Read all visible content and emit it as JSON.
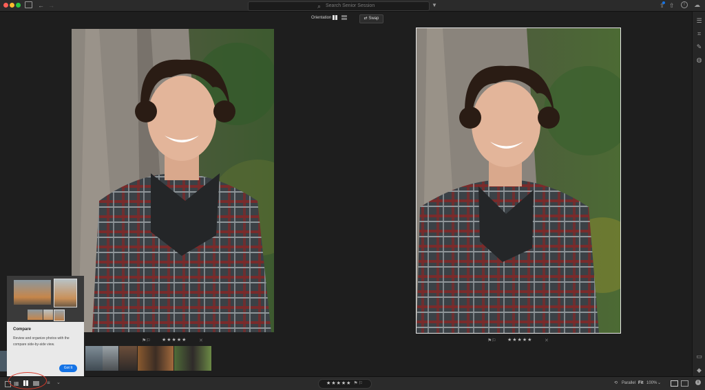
{
  "search": {
    "placeholder": "Search Senior Session"
  },
  "toolbar": {
    "orientation_label": "Orientation",
    "swap_label": "Swap"
  },
  "compare_popup": {
    "title": "Compare",
    "body": "Review and organize photos with the compare side-by-side view.",
    "button_label": "Got It"
  },
  "photo_left": {
    "rating": "★★★★★"
  },
  "photo_right": {
    "rating": "★★★★★"
  },
  "bottom_bar": {
    "rating": "★★★★★",
    "view_mode": "Parallel",
    "fit_label": "Fit",
    "zoom": "100%"
  },
  "colors": {
    "accent": "#1473e6",
    "highlight_circle": "#d83a2b",
    "close_dot": "#ff5f57",
    "minimize_dot": "#febc2e",
    "zoom_dot": "#28c840"
  },
  "icons": {
    "top_left": [
      "sidebar-toggle-icon",
      "back-arrow-icon",
      "forward-arrow-icon"
    ],
    "top_right": [
      "share-icon",
      "help-icon",
      "cloud-icon",
      "filter-icon"
    ],
    "right_panel": [
      "edit-sliders-icon",
      "crop-icon",
      "healing-brush-icon",
      "masking-icon",
      "comment-icon",
      "tag-icon",
      "info-icon"
    ]
  }
}
